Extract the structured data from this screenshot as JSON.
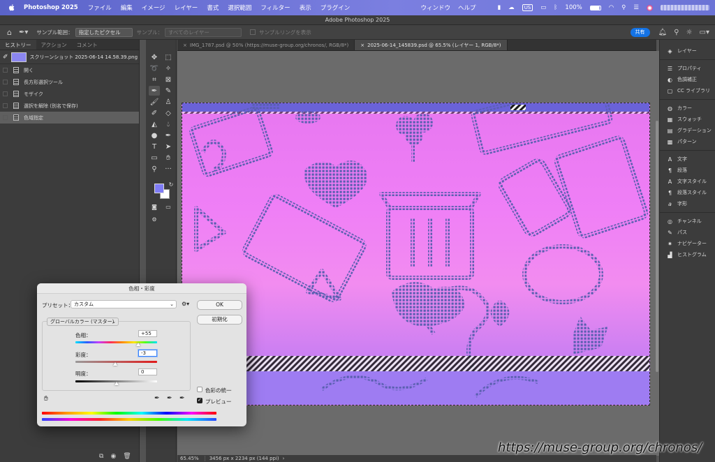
{
  "menubar": {
    "app": "Photoshop 2025",
    "items": [
      "ファイル",
      "編集",
      "イメージ",
      "レイヤー",
      "書式",
      "選択範囲",
      "フィルター",
      "表示",
      "プラグイン"
    ],
    "right": [
      "ウィンドウ",
      "ヘルプ"
    ],
    "input_source": "US",
    "battery": "100%"
  },
  "window_title": "Adobe Photoshop 2025",
  "options": {
    "sample_label": "サンプル範囲：",
    "sample_value": "指定したピクセル",
    "sample2_label": "サンプル：",
    "sample2_value": "すべてのレイヤー",
    "sample_ring": "サンプルリングを表示",
    "share": "共有"
  },
  "left_panel": {
    "tabs": [
      "ヒストリー",
      "アクション",
      "コメント"
    ],
    "snapshot": "スクリーンショット 2025-06-14 14.58.39.png",
    "history": [
      "開く",
      "長方形選択ツール",
      "モザイク",
      "選択を解除 (別名で保存)",
      "色域指定"
    ]
  },
  "doc_tabs": [
    "IMG_1787.psd @ 50% (https://muse-group.org/chronos/, RGB/8*)",
    "2025-06-14_145839.psd @ 65.5% (レイヤー 1, RGB/8*)"
  ],
  "status": {
    "zoom": "65.45%",
    "size": "3456 px x 2234 px (144 ppi)"
  },
  "right_panel": {
    "group1": [
      "レイヤー"
    ],
    "group2": [
      "プロパティ",
      "色調補正",
      "CC ライブラリ"
    ],
    "group3": [
      "カラー",
      "スウォッチ",
      "グラデーション",
      "パターン"
    ],
    "group4": [
      "文字",
      "段落",
      "文字スタイル",
      "段落スタイル",
      "字形"
    ],
    "group5": [
      "チャンネル",
      "パス",
      "ナビゲーター",
      "ヒストグラム"
    ]
  },
  "dialog": {
    "title": "色相・彩度",
    "preset_label": "プリセット：",
    "preset_value": "カスタム",
    "ok": "OK",
    "reset": "初期化",
    "channel": "グローバルカラー (マスター)",
    "hue_label": "色相：",
    "hue_value": "+55",
    "hue_level": 0.77,
    "sat_label": "彩度：",
    "sat_value": "-3",
    "sat_level": 0.49,
    "light_label": "明度：",
    "light_value": "0",
    "light_level": 0.5,
    "colorize": "色彩の統一",
    "preview": "プレビュー",
    "preview_checked": true
  },
  "watermark": "https://muse-group.org/chronos/"
}
